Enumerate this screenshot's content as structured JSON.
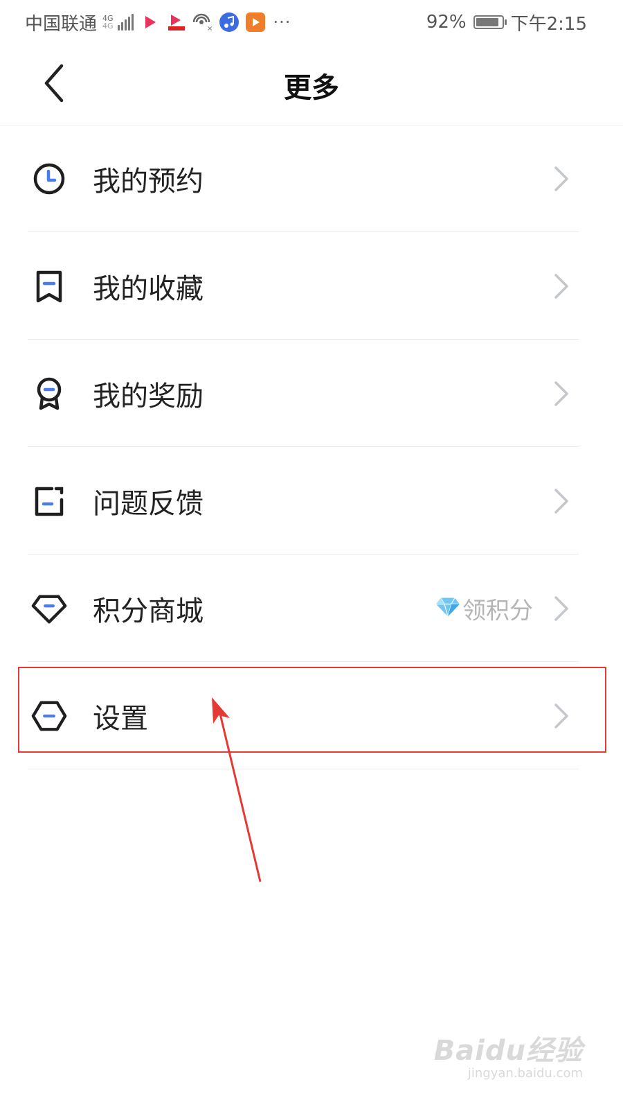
{
  "status_bar": {
    "carrier": "中国联通",
    "network_type": "4G",
    "network_sub": "4G",
    "battery_percent": "92%",
    "battery_level": 0.92,
    "time": "下午2:15",
    "app_icons": [
      {
        "name": "youku-icon",
        "color": "#e8335d"
      },
      {
        "name": "video-app-icon",
        "color": "#e8335d"
      },
      {
        "name": "hotspot-icon",
        "color": "#666666"
      },
      {
        "name": "music-icon",
        "color": "#3d6be0"
      },
      {
        "name": "player-icon",
        "color": "#f07d2a"
      }
    ],
    "more_dots": "···"
  },
  "header": {
    "back_icon": "chevron-left-icon",
    "title": "更多"
  },
  "menu": {
    "items": [
      {
        "label": "我的预约",
        "icon": "clock-icon"
      },
      {
        "label": "我的收藏",
        "icon": "bookmark-icon"
      },
      {
        "label": "我的奖励",
        "icon": "award-medal-icon"
      },
      {
        "label": "问题反馈",
        "icon": "feedback-edit-icon"
      },
      {
        "label": "积分商城",
        "icon": "diamond-icon",
        "extra_text": "领积分",
        "extra_icon": "blue-gem-icon"
      },
      {
        "label": "设置",
        "icon": "hexagon-settings-icon"
      }
    ]
  },
  "colors": {
    "accent_blue": "#4b7bec",
    "icon_stroke": "#1f1f1f",
    "chevron": "#c4c7cc",
    "annotation_red": "#e53935"
  },
  "annotation": {
    "highlighted_item": "设置"
  },
  "watermark": {
    "logo": "Baidu经验",
    "url": "jingyan.baidu.com"
  }
}
